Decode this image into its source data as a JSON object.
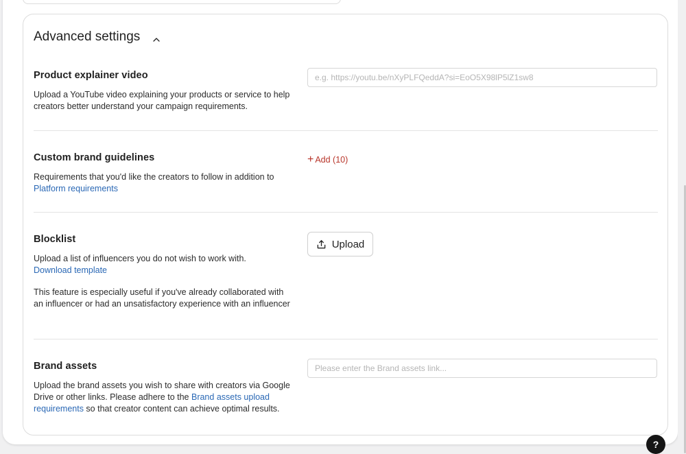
{
  "advanced": {
    "title": "Advanced settings",
    "chevron_icon": "chevron-up-icon"
  },
  "product_video": {
    "title": "Product explainer video",
    "description": "Upload a YouTube video explaining your products or service to help creators better understand your campaign requirements.",
    "placeholder": "e.g. https://youtu.be/nXyPLFQeddA?si=EoO5X98lP5lZ1sw8",
    "value": ""
  },
  "brand_guidelines": {
    "title": "Custom brand guidelines",
    "description": "Requirements that you'd like the creators to follow in addition to",
    "link": "Platform requirements",
    "add_label": "Add (10)",
    "add_icon": "plus-icon",
    "accent_color": "#b8352a"
  },
  "blocklist": {
    "title": "Blocklist",
    "description": "Upload a list of influencers you do not wish to work with.",
    "link": "Download template",
    "note": "This feature is especially useful if you've already collaborated with an influencer or had an unsatisfactory experience with an influencer",
    "upload_label": "Upload",
    "upload_icon": "upload-icon"
  },
  "brand_assets": {
    "title": "Brand assets",
    "description_before": "Upload the brand assets you wish to share with creators via Google Drive or other links. Please adhere to the ",
    "link": "Brand assets upload requirements",
    "description_after": " so that creator content can achieve optimal results.",
    "placeholder": "Please enter the Brand assets link...",
    "value": ""
  },
  "help": {
    "label": "?",
    "icon": "help-icon"
  },
  "colors": {
    "link": "#2a68b5",
    "help_bg": "#151515"
  }
}
